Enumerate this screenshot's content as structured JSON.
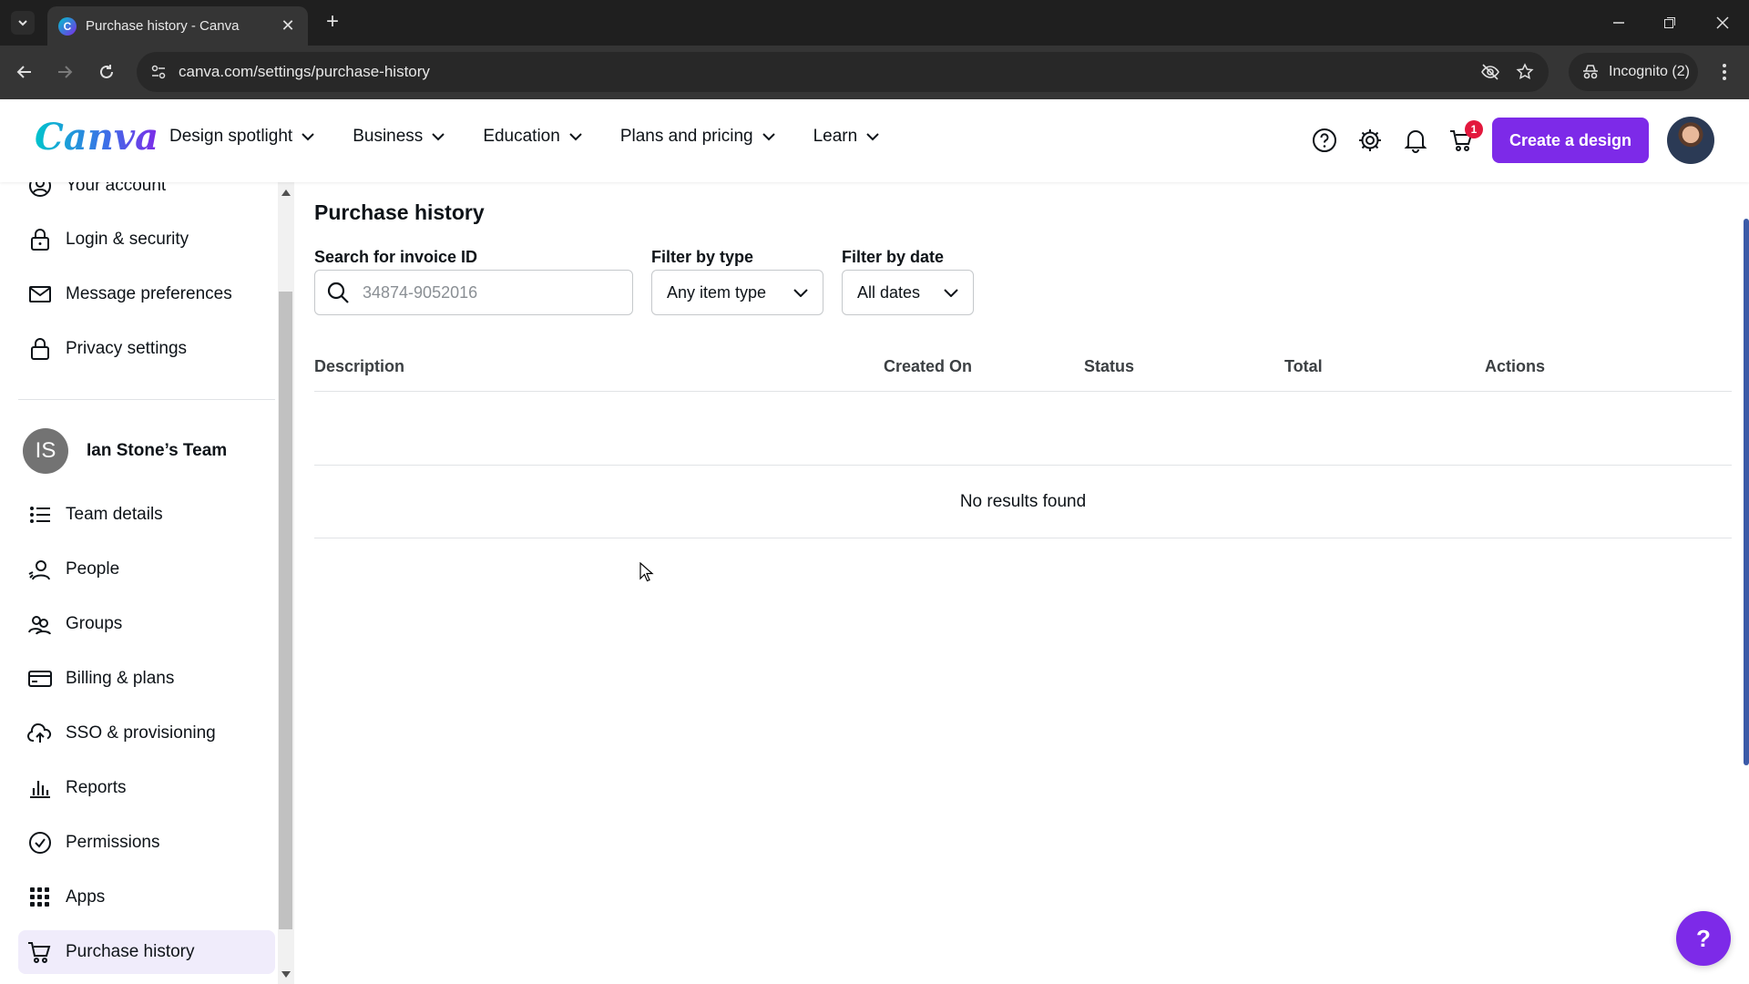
{
  "browser": {
    "tab_title": "Purchase history - Canva",
    "url": "canva.com/settings/purchase-history",
    "incognito_label": "Incognito (2)"
  },
  "header": {
    "logo": "Canva",
    "nav": [
      {
        "label": "Design spotlight"
      },
      {
        "label": "Business"
      },
      {
        "label": "Education"
      },
      {
        "label": "Plans and pricing"
      },
      {
        "label": "Learn"
      }
    ],
    "cart_count": "1",
    "create_label": "Create a design",
    "brand_color": "#7d2ae8"
  },
  "sidebar": {
    "personal_items": [
      {
        "label": "Your account",
        "icon": "user-circle-icon"
      },
      {
        "label": "Login & security",
        "icon": "lock-icon"
      },
      {
        "label": "Message preferences",
        "icon": "envelope-icon"
      },
      {
        "label": "Privacy settings",
        "icon": "privacy-lock-icon"
      }
    ],
    "team": {
      "initials": "IS",
      "name": "Ian Stone’s Team"
    },
    "team_items": [
      {
        "label": "Team details",
        "icon": "list-icon"
      },
      {
        "label": "People",
        "icon": "people-icon"
      },
      {
        "label": "Groups",
        "icon": "groups-icon"
      },
      {
        "label": "Billing & plans",
        "icon": "card-icon"
      },
      {
        "label": "SSO & provisioning",
        "icon": "cloud-upload-icon"
      },
      {
        "label": "Reports",
        "icon": "bar-chart-icon"
      },
      {
        "label": "Permissions",
        "icon": "check-circle-icon"
      },
      {
        "label": "Apps",
        "icon": "grid-icon"
      },
      {
        "label": "Purchase history",
        "icon": "cart-icon",
        "active": true
      }
    ]
  },
  "main": {
    "title": "Purchase history",
    "search_label": "Search for invoice ID",
    "search_placeholder": "34874-9052016",
    "type_label": "Filter by type",
    "type_value": "Any item type",
    "date_label": "Filter by date",
    "date_value": "All dates",
    "columns": [
      "Description",
      "Created On",
      "Status",
      "Total",
      "Actions"
    ],
    "empty_text": "No results found"
  },
  "help_fab": "?"
}
